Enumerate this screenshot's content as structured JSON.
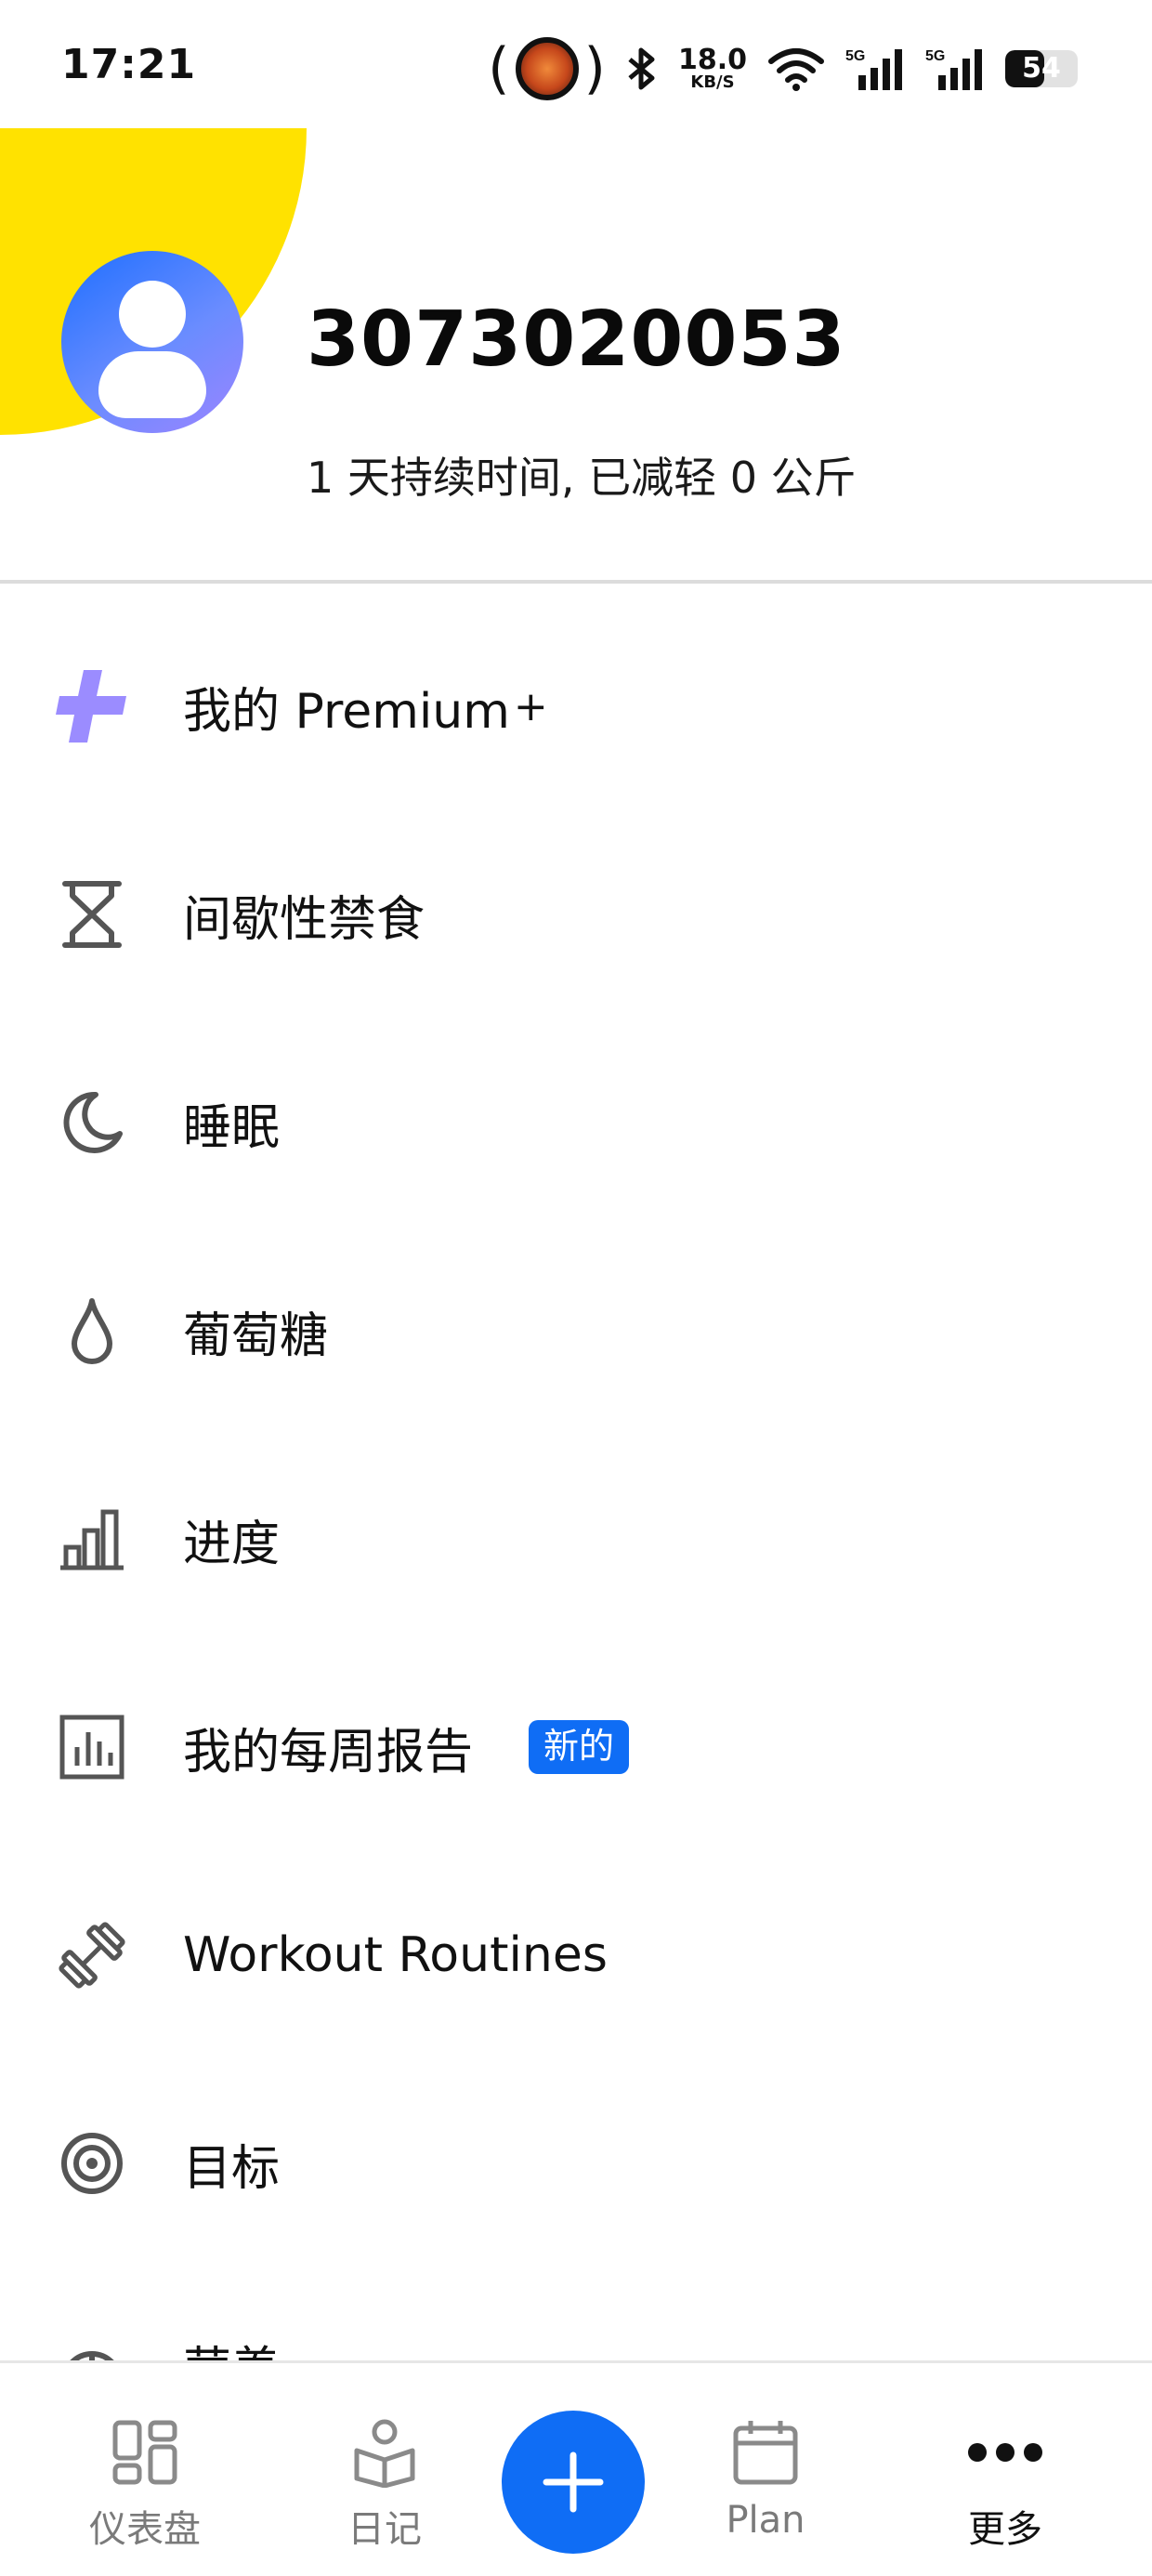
{
  "status_bar": {
    "time": "17:21",
    "net_speed_value": "18.0",
    "net_speed_unit": "KB/S",
    "network_1": "5G",
    "network_2": "5G",
    "battery_level": "54"
  },
  "profile": {
    "username": "3073020053",
    "summary": "1 天持续时间, 已减轻 0 公斤",
    "accent_color": "#ffe200",
    "avatar_gradient": [
      "#1e6fff",
      "#9c84ff"
    ]
  },
  "menu": {
    "items": [
      {
        "label": "我的 Premium",
        "suffix": "+",
        "icon": "premium-plus-icon"
      },
      {
        "label": "间歇性禁食",
        "icon": "hourglass-icon"
      },
      {
        "label": "睡眠",
        "icon": "moon-icon"
      },
      {
        "label": "葡萄糖",
        "icon": "drop-icon"
      },
      {
        "label": "进度",
        "icon": "bar-chart-icon"
      },
      {
        "label": "我的每周报告",
        "badge": "新的",
        "icon": "report-chart-icon"
      },
      {
        "label": "Workout Routines",
        "icon": "dumbbell-icon"
      },
      {
        "label": "目标",
        "icon": "target-icon"
      },
      {
        "label": "营养",
        "icon": "nutrition-icon"
      }
    ],
    "badge_color": "#0f6df5"
  },
  "bottom_nav": {
    "items": [
      {
        "label": "仪表盘",
        "icon": "dashboard-icon",
        "active": false
      },
      {
        "label": "日记",
        "icon": "diary-icon",
        "active": false
      },
      {
        "label": "Plan",
        "icon": "calendar-icon",
        "active": false
      },
      {
        "label": "更多",
        "icon": "more-dots-icon",
        "active": true
      }
    ],
    "fab_icon": "add-icon",
    "fab_color": "#0f6df5"
  }
}
